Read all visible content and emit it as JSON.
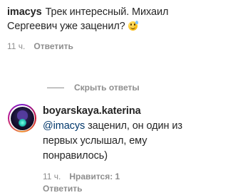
{
  "comment": {
    "username": "imacys",
    "text": "Трек интересный. Михаил Сергеевич уже заценил?",
    "emoji": "grinning-sweat-emoji",
    "time": "11 ч.",
    "reply_label": "Ответить"
  },
  "replies_toggle": {
    "label": "Скрыть ответы"
  },
  "reply": {
    "username": "boyarskaya.katerina",
    "mention": "@imacys",
    "text": "заценил, он один из первых услышал, ему понравилось)",
    "time": "11 ч.",
    "likes_label": "Нравится: 1",
    "reply_label": "Ответить"
  },
  "colors": {
    "text": "#262626",
    "muted": "#8e8e8e",
    "mention": "#00376b"
  }
}
